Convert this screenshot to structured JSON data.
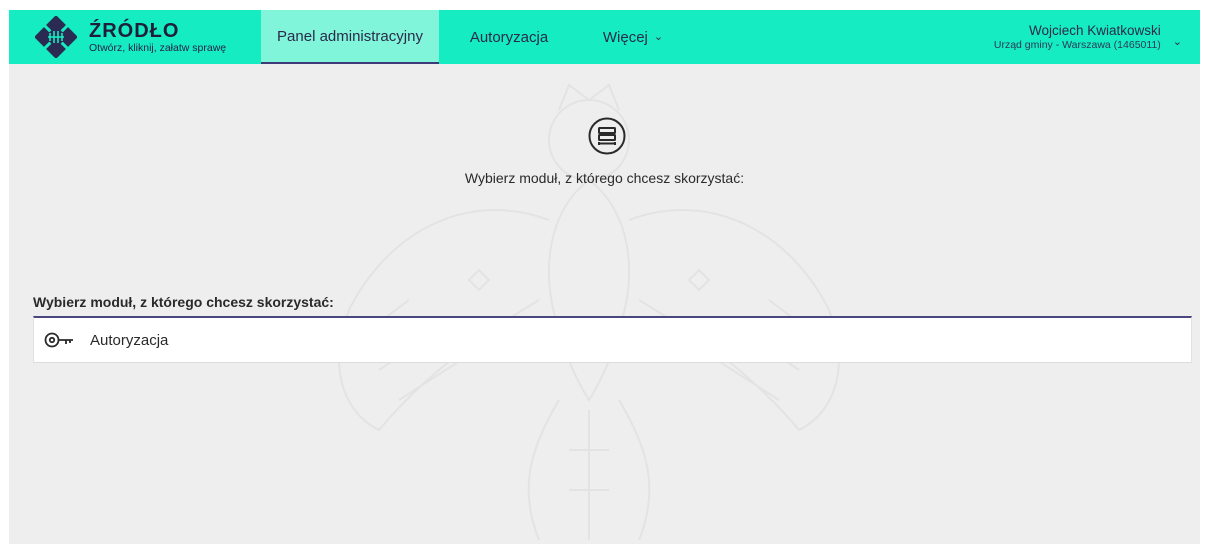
{
  "brand": {
    "name": "ŹRÓDŁO",
    "tagline": "Otwórz, kliknij, załatw sprawę",
    "colors": {
      "bar": "#15ecc1",
      "active_tab": "#80f5da",
      "ink": "#1f1f3a"
    }
  },
  "nav": {
    "items": [
      {
        "label": "Panel administracyjny",
        "active": true
      },
      {
        "label": "Autoryzacja",
        "active": false
      },
      {
        "label": "Więcej",
        "active": false,
        "icon": "chevron-down-icon"
      }
    ]
  },
  "user": {
    "name": "Wojciech Kwiatkowski",
    "office": "Urząd gminy - Warszawa (1465011)",
    "icon": "chevron-down-icon"
  },
  "main": {
    "header_icon": "modules-icon",
    "prompt": "Wybierz moduł, z którego chcesz skorzystać:",
    "section_label": "Wybierz moduł, z którego chcesz skorzystać:",
    "modules": [
      {
        "label": "Autoryzacja",
        "icon": "key-icon"
      }
    ]
  }
}
